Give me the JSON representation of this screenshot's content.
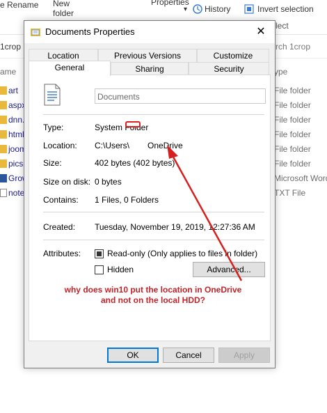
{
  "explorer": {
    "ribbon": {
      "rename_fragment": "e Rename",
      "new_folder": "New\nfolder",
      "properties_fragment": "Properties",
      "history": "History",
      "invert_selection": "Invert selection",
      "select_fragment": "lect"
    },
    "address": {
      "left_fragment": "1crop",
      "search_fragment": "rch 1crop"
    },
    "columns": {
      "name_fragment": "ame",
      "type_fragment": "ype"
    },
    "files": [
      {
        "name": "art",
        "type": "File folder"
      },
      {
        "name": "aspx.",
        "type": "File folder"
      },
      {
        "name": "dnn.s",
        "type": "File folder"
      },
      {
        "name": "html",
        "type": "File folder"
      },
      {
        "name": "joom",
        "type": "File folder"
      },
      {
        "name": "pics",
        "type": "File folder"
      },
      {
        "name": "Grow",
        "type": "Microsoft Word"
      },
      {
        "name": "notes",
        "type": "TXT File"
      }
    ]
  },
  "dialog": {
    "title": "Documents Properties",
    "close_glyph": "✕",
    "tabs_back": [
      "Location",
      "Previous Versions",
      "Customize"
    ],
    "tabs_front": [
      "General",
      "Sharing",
      "Security"
    ],
    "active_tab": "General",
    "folder_name": "Documents",
    "props": {
      "type": {
        "label": "Type:",
        "value": "System Folder"
      },
      "location": {
        "label": "Location:",
        "value_prefix": "C:\\Users\\",
        "value_suffix": "OneDrive"
      },
      "size": {
        "label": "Size:",
        "value": "402 bytes (402 bytes)"
      },
      "size_on_disk": {
        "label": "Size on disk:",
        "value": "0 bytes"
      },
      "contains": {
        "label": "Contains:",
        "value": "1 Files, 0 Folders"
      },
      "created": {
        "label": "Created:",
        "value": "Tuesday, November 19, 2019, 12:27:36 AM"
      }
    },
    "attributes": {
      "label": "Attributes:",
      "readonly": {
        "label": "Read-only (Only applies to files in folder)",
        "checked": true
      },
      "hidden": {
        "label": "Hidden",
        "checked": false
      },
      "advanced_button": "Advanced..."
    },
    "buttons": {
      "ok": "OK",
      "cancel": "Cancel",
      "apply": "Apply"
    }
  },
  "annotation": {
    "text": "why does win10 put the location in OneDrive\nand not on the local HDD?",
    "color": "#c0242a"
  },
  "colors": {
    "accent": "#0078d7",
    "annotation_red": "#c0242a",
    "redaction_red": "#e02020"
  }
}
